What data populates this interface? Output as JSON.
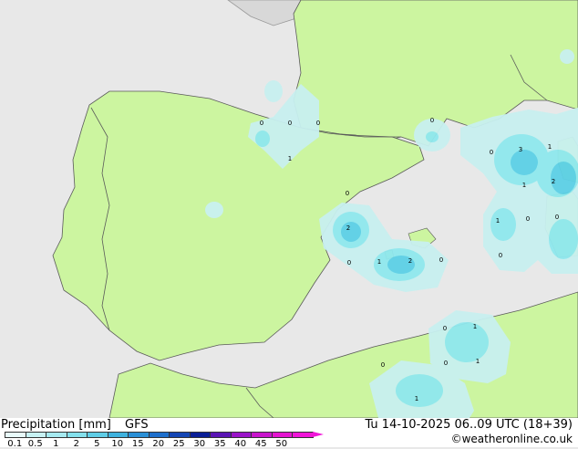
{
  "map": {
    "colors": {
      "sea": "#e8e8e8",
      "land": "#ccf5a0",
      "land_other": "#d8d8d8",
      "border": "#5a5a5a",
      "precip_light": "#c8f0f0",
      "precip_mid": "#8fe8ee",
      "precip_heavy": "#5cd0e6"
    },
    "grid_values": [
      "0",
      "0",
      "0",
      "1",
      "0",
      "0",
      "2",
      "0",
      "1",
      "2",
      "0",
      "0",
      "3",
      "1",
      "2",
      "1",
      "0",
      "0",
      "1",
      "0",
      "0",
      "1",
      "0",
      "1",
      "1",
      "0"
    ]
  },
  "footer": {
    "title": "Precipitation [mm]",
    "model": "GFS",
    "datetime": "Tu 14-10-2025 06..09 UTC (18+39)",
    "credit": "©weatheronline.co.uk",
    "scale_labels": [
      "0.1",
      "0.5",
      "1",
      "2",
      "5",
      "10",
      "15",
      "20",
      "25",
      "30",
      "35",
      "40",
      "45",
      "50"
    ],
    "scale_colors": [
      "#e8fafa",
      "#c8f2f4",
      "#a6eaf0",
      "#84e0ec",
      "#5fcde6",
      "#3fb2de",
      "#2a8fd6",
      "#1e6fcc",
      "#1446b4",
      "#0a1e96",
      "#5a14b4",
      "#9a14c8",
      "#c814cc",
      "#e414d0",
      "#f014d8"
    ]
  }
}
